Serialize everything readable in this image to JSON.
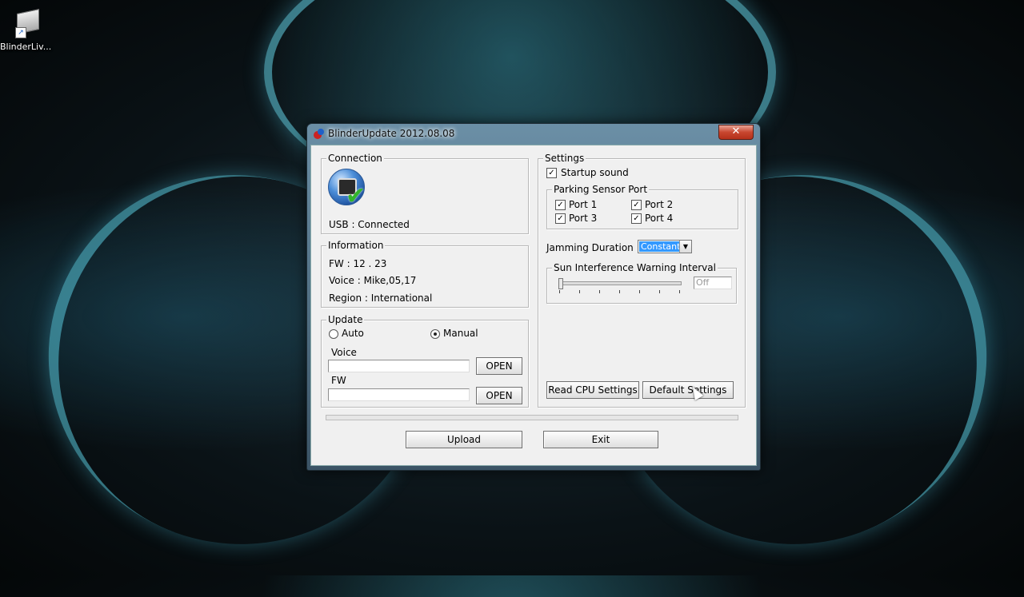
{
  "desktop": {
    "icon_label": "BlinderLiv..."
  },
  "window": {
    "title": "BlinderUpdate 2012.08.08",
    "close_symbol": "✕"
  },
  "connection": {
    "legend": "Connection",
    "status": "USB : Connected"
  },
  "information": {
    "legend": "Information",
    "fw": "FW : 12 . 23",
    "voice": "Voice : Mike,05,17",
    "region": "Region : International"
  },
  "update": {
    "legend": "Update",
    "auto_label": "Auto",
    "manual_label": "Manual",
    "selected_mode": "Manual",
    "voice_label": "Voice",
    "voice_value": "",
    "fw_label": "FW",
    "fw_value": "",
    "open_voice": "OPEN",
    "open_fw": "OPEN"
  },
  "settings": {
    "legend": "Settings",
    "startup_sound": {
      "label": "Startup sound",
      "checked": true
    },
    "parking": {
      "legend": "Parking Sensor Port",
      "ports": [
        {
          "label": "Port 1",
          "checked": true
        },
        {
          "label": "Port 2",
          "checked": true
        },
        {
          "label": "Port 3",
          "checked": true
        },
        {
          "label": "Port 4",
          "checked": true
        }
      ]
    },
    "jamming": {
      "label": "Jamming Duration",
      "value": "Constant"
    },
    "sun": {
      "legend": "Sun Interference Warning Interval",
      "value": "Off",
      "slider_level": 0
    },
    "read_cpu": "Read CPU Settings",
    "default_settings": "Default Settings"
  },
  "buttons": {
    "upload": "Upload",
    "exit": "Exit"
  },
  "glyphs": {
    "check": "✓",
    "dropdown": "▼"
  }
}
